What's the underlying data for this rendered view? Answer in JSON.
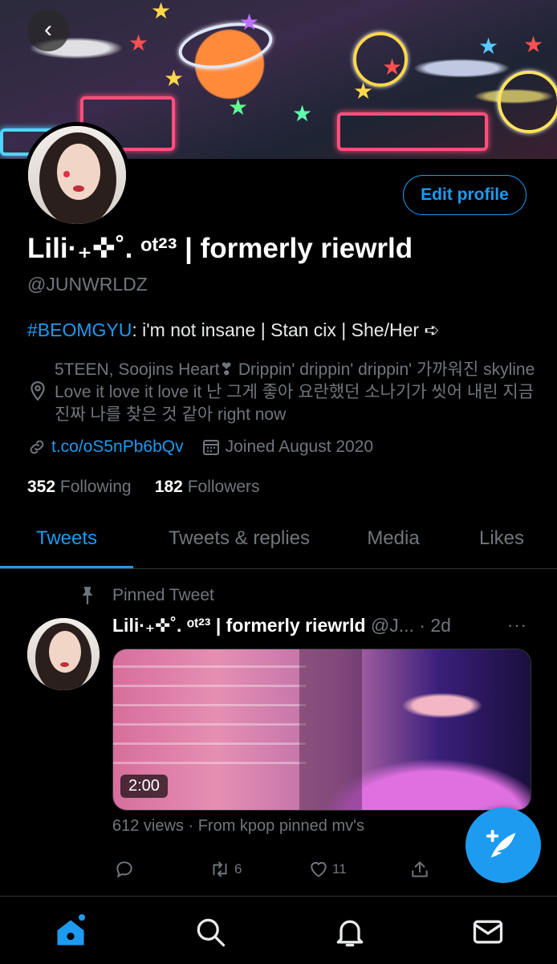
{
  "header": {
    "back_icon": "back-chevron-icon"
  },
  "profile": {
    "edit_label": "Edit profile",
    "display_name": "Lili·₊✜˚. ᵒᵗ²³ | formerly riewrld",
    "handle": "@JUNWRLDZ",
    "bio_hashtag": "#BEOMGYU",
    "bio_rest": ": i'm not insane | Stan cix | She/Her ➪",
    "location": "5TEEN, Soojins Heart❣ Drippin' drippin' drippin' 가까워진 skyline Love it love it love it 난 그게 좋아 요란했던 소나기가 씻어 내린 지금 진짜 나를 찾은 것 같아 right now",
    "url": "t.co/oS5nPb6bQv",
    "joined": "Joined August 2020",
    "following_count": "352",
    "following_label": "Following",
    "followers_count": "182",
    "followers_label": "Followers"
  },
  "tabs": [
    {
      "label": "Tweets",
      "active": true
    },
    {
      "label": "Tweets & replies",
      "active": false
    },
    {
      "label": "Media",
      "active": false
    },
    {
      "label": "Likes",
      "active": false
    }
  ],
  "pinned": {
    "label": "Pinned Tweet",
    "author": "Lili·₊✜˚. ᵒᵗ²³ | formerly riewrld",
    "handle_trunc": "@J...",
    "time": "· 2d",
    "more": "···",
    "duration": "2:00",
    "views": "612 views · From kpop pinned mv's",
    "retweets": "6",
    "likes": "11"
  },
  "colors": {
    "accent": "#1d9bf0",
    "muted": "#71767b",
    "background": "#000000"
  }
}
